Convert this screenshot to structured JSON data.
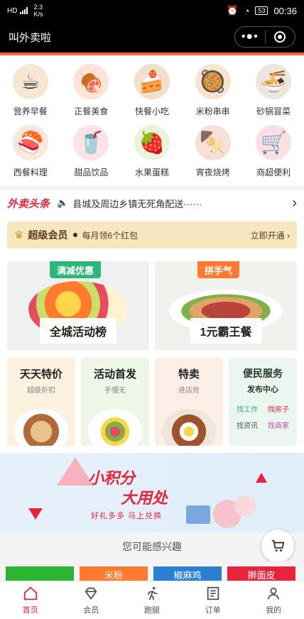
{
  "status": {
    "signal_type": "HD",
    "net_speed_value": "2.3",
    "net_speed_unit": "K/s",
    "battery": "53",
    "time": "00:36"
  },
  "app": {
    "title": "叫外卖啦",
    "menu_glyph": "•●•"
  },
  "categories": [
    {
      "label": "营养早餐",
      "icon": "bread-icon"
    },
    {
      "label": "正餐美食",
      "icon": "dish-icon"
    },
    {
      "label": "快餐小吃",
      "icon": "fastfood-icon"
    },
    {
      "label": "米粉串串",
      "icon": "noodle-icon"
    },
    {
      "label": "砂锅冒菜",
      "icon": "pot-icon"
    },
    {
      "label": "西餐料理",
      "icon": "sushi-icon"
    },
    {
      "label": "甜品饮品",
      "icon": "drink-icon"
    },
    {
      "label": "水果蛋糕",
      "icon": "fruit-icon"
    },
    {
      "label": "宵夜烧烤",
      "icon": "bbq-icon"
    },
    {
      "label": "商超便利",
      "icon": "cart-icon"
    }
  ],
  "headline": {
    "logo": "外卖头条",
    "text": "县城及周边乡镇无死角配送······"
  },
  "vip": {
    "name": "超级会员",
    "desc": "每月领6个红包",
    "action": "立即开通 ›"
  },
  "promos": [
    {
      "tag": "满减优惠",
      "caption": "全城活动榜"
    },
    {
      "tag": "拼手气",
      "caption": "1元霸王餐"
    }
  ],
  "small_cards": [
    {
      "title": "天天特价",
      "sub": "超级折扣"
    },
    {
      "title": "活动首发",
      "sub": "手慢无"
    },
    {
      "title": "特卖",
      "sub": "进店抢"
    }
  ],
  "service": {
    "title": "便民服务",
    "sub": "发布中心",
    "links": [
      "找工作",
      "找房子",
      "找资讯",
      "找商家"
    ]
  },
  "banner": {
    "line1": "小积分",
    "line2": "大用处",
    "sub": "好礼多多 马上兑换"
  },
  "interest": {
    "title": "您可能感兴趣"
  },
  "category_tabs": [
    "",
    "米粉",
    "椒麻鸡",
    "擀面皮"
  ],
  "nav": [
    {
      "label": "首页",
      "icon": "home-icon"
    },
    {
      "label": "会员",
      "icon": "diamond-icon"
    },
    {
      "label": "跑腿",
      "icon": "runner-icon"
    },
    {
      "label": "订单",
      "icon": "order-icon"
    },
    {
      "label": "我的",
      "icon": "user-icon"
    }
  ],
  "colors": {
    "accent": "#ff6a2a",
    "brand_red": "#e8243c",
    "vip_bg": "#f6e7bf",
    "tag_green": "#2db57a",
    "tag_orange": "#ff7a2e"
  }
}
